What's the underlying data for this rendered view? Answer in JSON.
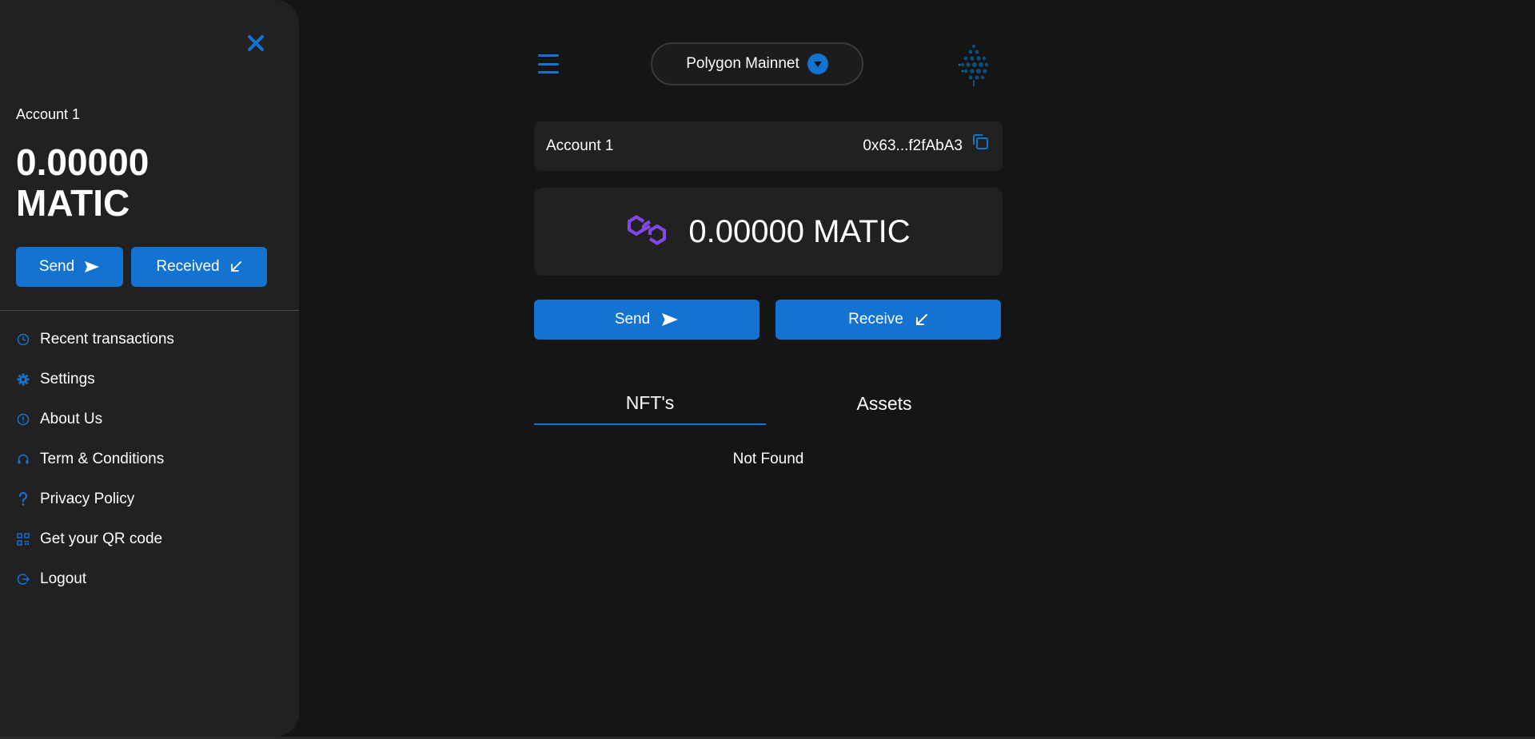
{
  "drawer": {
    "account_label": "Account 1",
    "balance": "0.00000 MATIC",
    "send_label": "Send",
    "received_label": "Received",
    "menu": [
      {
        "label": "Recent transactions",
        "icon": "clock-icon"
      },
      {
        "label": "Settings",
        "icon": "gear-icon"
      },
      {
        "label": "About Us",
        "icon": "info-icon"
      },
      {
        "label": "Term & Conditions",
        "icon": "headset-icon"
      },
      {
        "label": "Privacy Policy",
        "icon": "question-icon"
      },
      {
        "label": "Get your QR code",
        "icon": "qr-code-icon"
      },
      {
        "label": "Logout",
        "icon": "logout-icon"
      }
    ]
  },
  "header": {
    "network": "Polygon Mainnet"
  },
  "account": {
    "name": "Account 1",
    "address": "0x63...f2fAbA3"
  },
  "balance": {
    "text": "0.00000 MATIC",
    "token_icon": "polygon-matic-icon"
  },
  "actions": {
    "send_label": "Send",
    "receive_label": "Receive"
  },
  "tabs": [
    {
      "label": "NFT's",
      "active": true
    },
    {
      "label": "Assets",
      "active": false
    }
  ],
  "content": {
    "empty_message": "Not Found"
  },
  "colors": {
    "accent": "#1473d1",
    "background": "#151515",
    "panel": "#212121",
    "polygon_purple": "#8247e5"
  }
}
